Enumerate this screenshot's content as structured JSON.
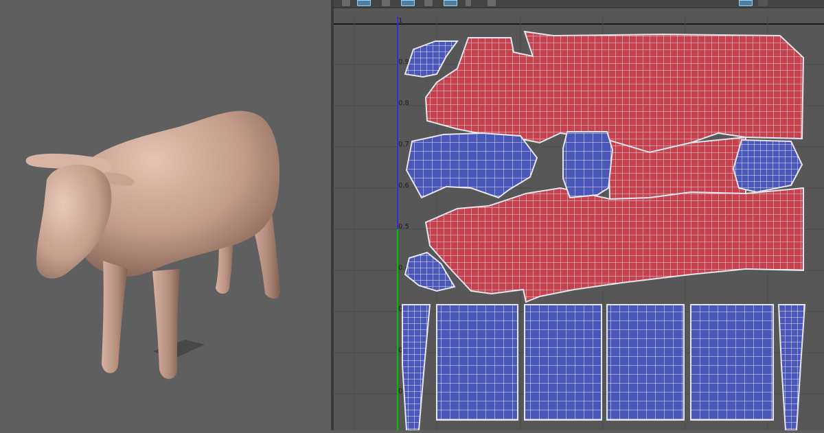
{
  "viewport": {
    "model": "cow",
    "material_color": "#c7a08e",
    "background": "#5f5f5f"
  },
  "uv_editor": {
    "toolbar": {
      "buttons": [
        "tool-1",
        "uv-select",
        "uv-move",
        "uv-scale",
        "tool-5",
        "checker-toggle",
        "camera-toggle",
        "tool-8",
        "display-mode",
        "more"
      ]
    },
    "v_axis_ticks": [
      "1",
      "0.9",
      "0.8",
      "0.7",
      "0.6",
      "0.5",
      "0.4",
      "0.3",
      "0.2",
      "0.1"
    ],
    "colors": {
      "front_facing": "#4a56b8",
      "back_facing": "#c4434f",
      "wire": "#e6e6f0",
      "u_axis": "#00c000",
      "v_axis": "#3030d0"
    },
    "shells": [
      "ear-top",
      "body-top",
      "leg-strip-left",
      "head",
      "tail-cap",
      "ear-bottom",
      "body-bottom",
      "leg-1",
      "leg-2",
      "leg-3",
      "leg-4",
      "leg-strip-right"
    ]
  }
}
